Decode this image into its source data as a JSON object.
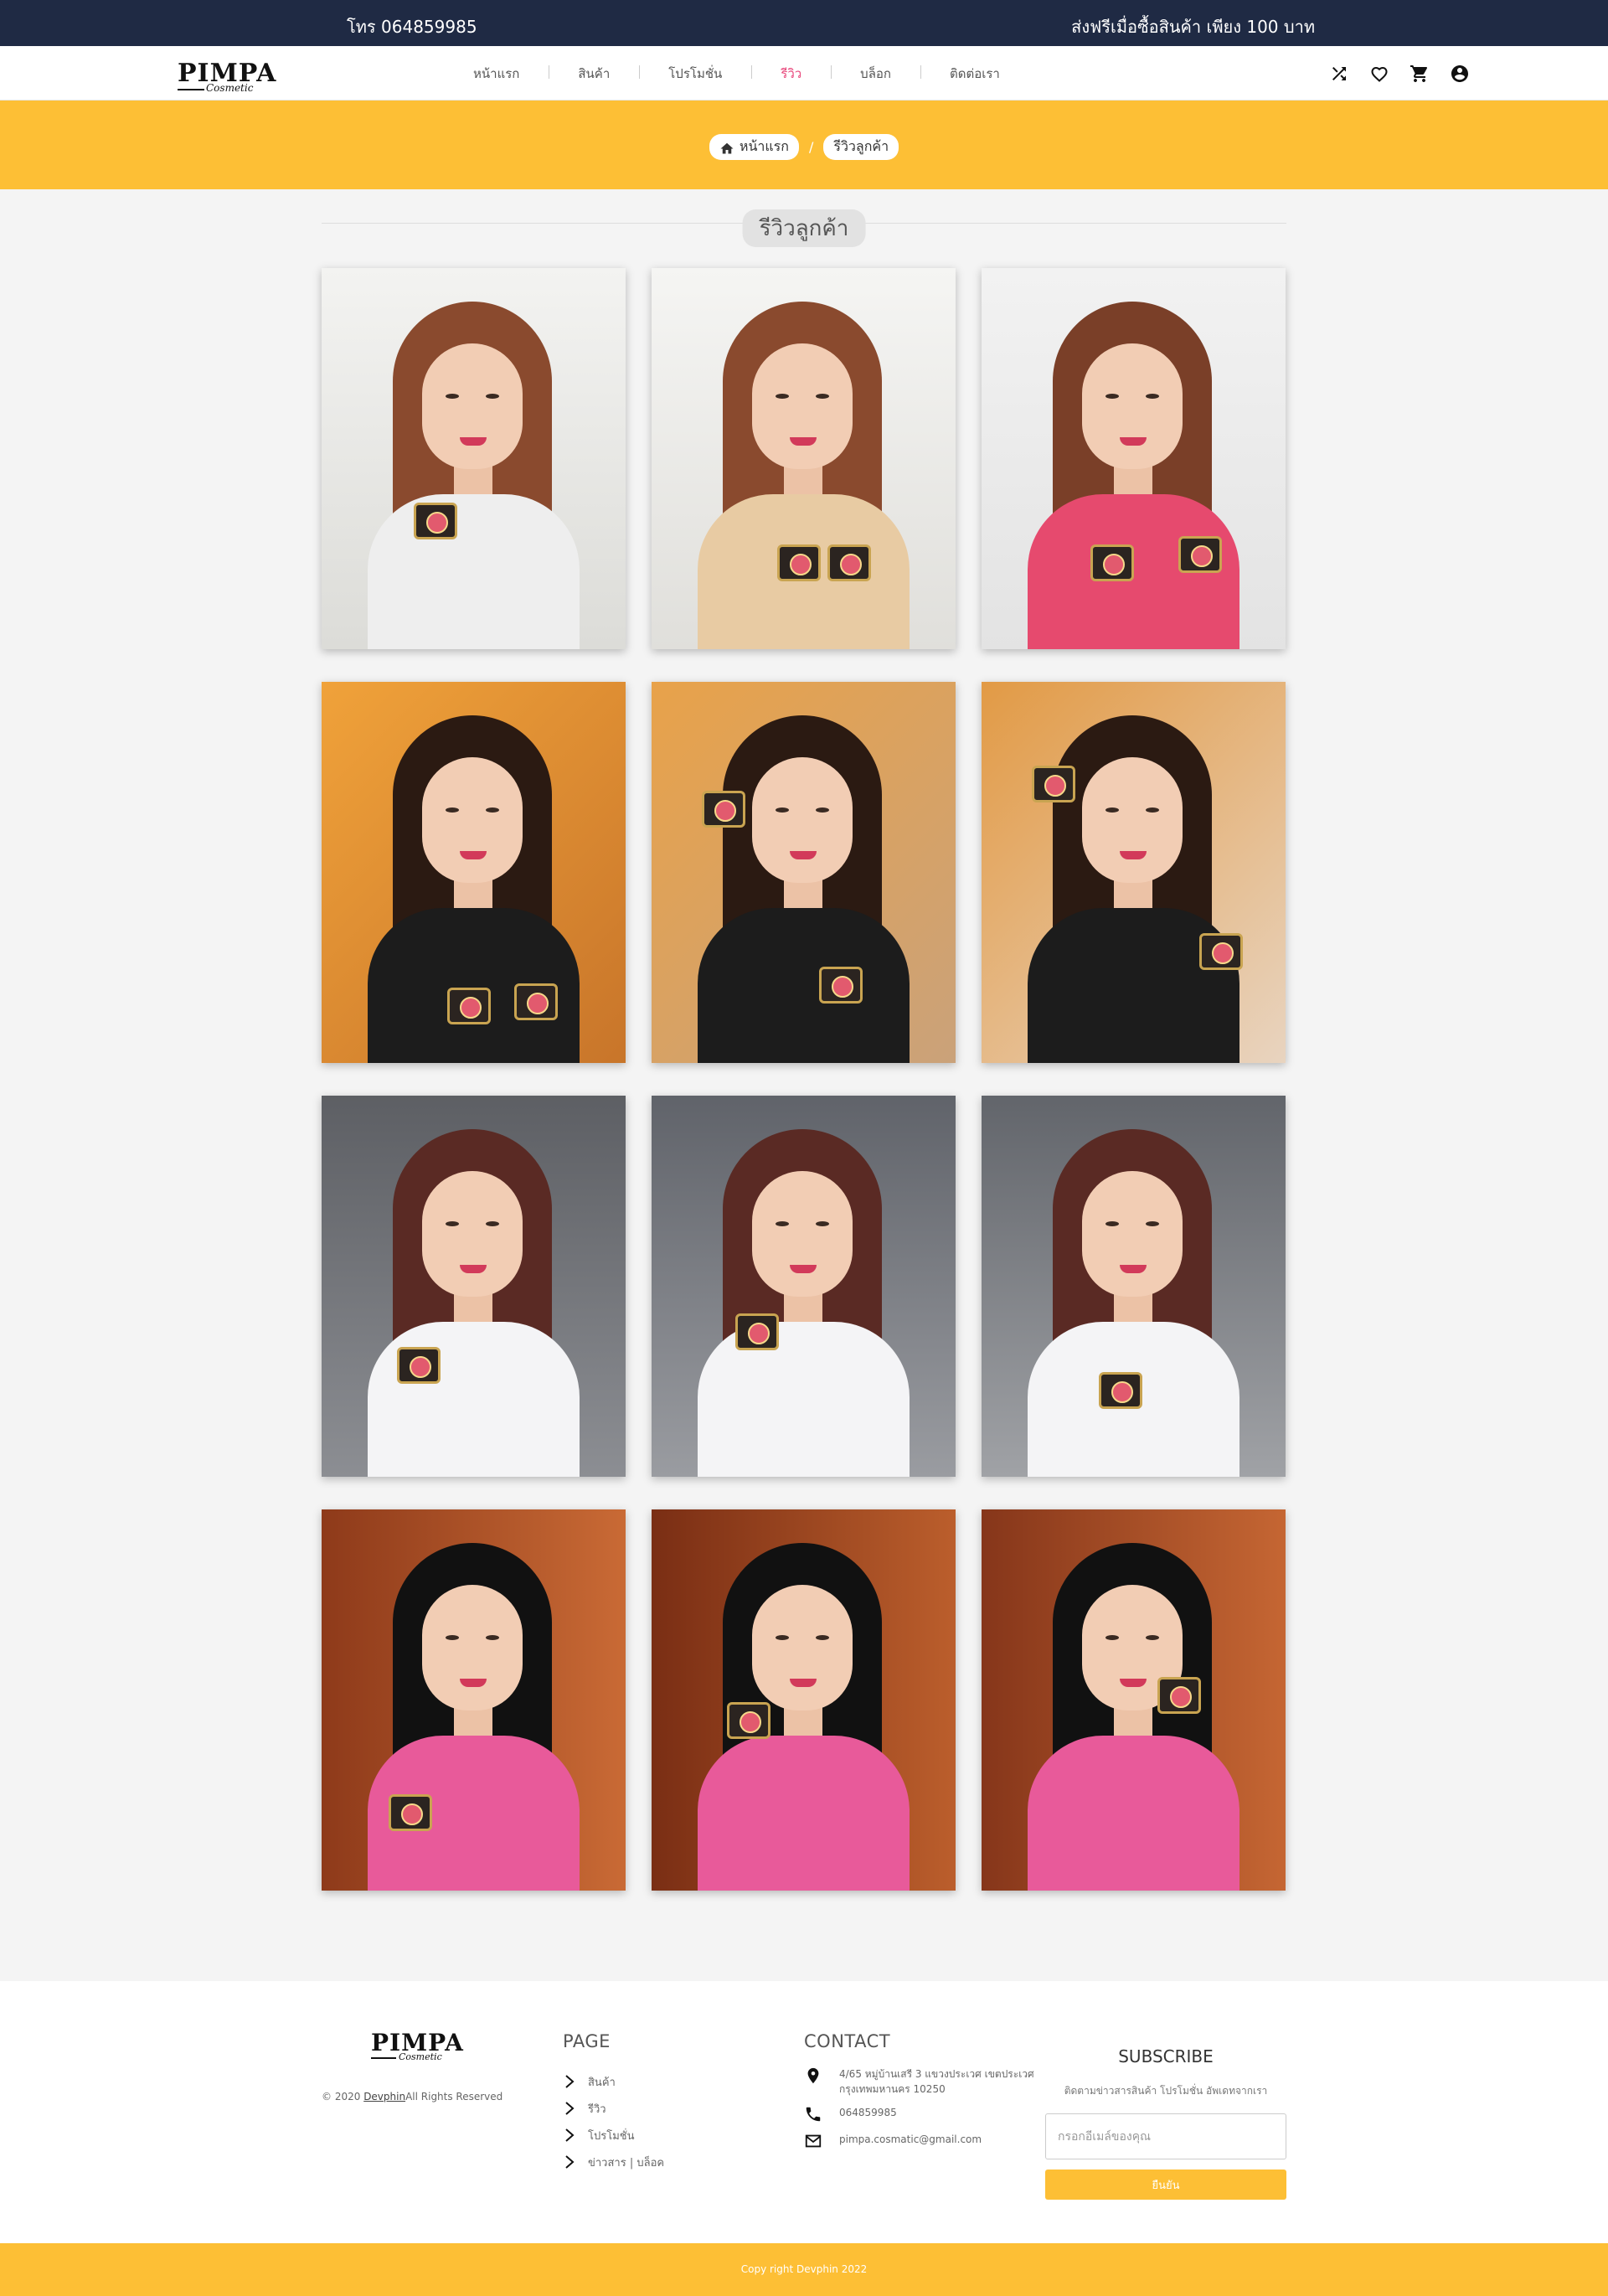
{
  "topbar": {
    "phone": "โทร 064859985",
    "promo": "ส่งฟรีเมื่อซื้อสินค้า เพียง 100 บาท"
  },
  "brand": {
    "name": "PIMPA",
    "sub": "Cosmetic"
  },
  "nav": {
    "items": [
      {
        "label": "หน้าแรก",
        "active": false
      },
      {
        "label": "สินค้า",
        "active": false
      },
      {
        "label": "โปรโมชั่น",
        "active": false
      },
      {
        "label": "รีวิว",
        "active": true
      },
      {
        "label": "บล็อก",
        "active": false
      },
      {
        "label": "ติดต่อเรา",
        "active": false
      }
    ],
    "icons": [
      "shuffle-icon",
      "heart-icon",
      "cart-icon",
      "account-icon"
    ]
  },
  "breadcrumb": {
    "home": "หน้าแรก",
    "separator": "/",
    "current": "รีวิวลูกค้า"
  },
  "section_title": "รีวิวลูกค้า",
  "gallery": {
    "photos": [
      {
        "alt": "review-photo-1"
      },
      {
        "alt": "review-photo-2"
      },
      {
        "alt": "review-photo-3"
      },
      {
        "alt": "review-photo-4"
      },
      {
        "alt": "review-photo-5"
      },
      {
        "alt": "review-photo-6"
      },
      {
        "alt": "review-photo-7"
      },
      {
        "alt": "review-photo-8"
      },
      {
        "alt": "review-photo-9"
      },
      {
        "alt": "review-photo-10"
      },
      {
        "alt": "review-photo-11"
      },
      {
        "alt": "review-photo-12"
      }
    ]
  },
  "footer": {
    "copyright_prefix": "© 2020",
    "copyright_link": "Devphin",
    "copyright_suffix": "All Rights Reserved",
    "page": {
      "title": "PAGE",
      "links": [
        "สินค้า",
        "รีวิว",
        "โปรโมชั่น",
        "ข่าวสาร | บล็อค"
      ]
    },
    "contact": {
      "title": "CONTACT",
      "address": "4/65 หมู่บ้านเสรี 3 แขวงประเวศ เขตประเวศ กรุงเทพมหานคร 10250",
      "phone": "064859985",
      "email": "pimpa.cosmatic@gmail.com"
    },
    "subscribe": {
      "title": "SUBSCRIBE",
      "text": "ติดตามข่าวสารสินค้า โปรโมชั่น อัพเดทจากเรา",
      "placeholder": "กรอกอีเมล์ของคุณ",
      "button": "ยืนยัน"
    }
  },
  "bottom_bar": "Copy right Devphin 2022",
  "colors": {
    "topbar": "#1f2a44",
    "accent": "#fdbf35",
    "active_link": "#e8457a"
  }
}
